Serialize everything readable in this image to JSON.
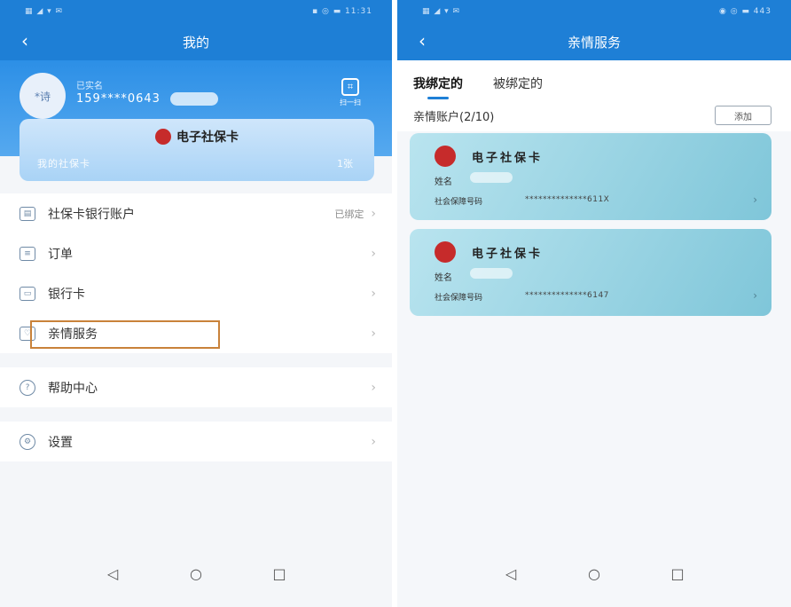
{
  "left": {
    "status_left": "▦ ◢ ▾ ✉",
    "status_right": "▪ ◎ ▬ 11:31",
    "title": "我的",
    "profile": {
      "avatar_text": "*诗",
      "name": "已实名",
      "phone": "159****0643",
      "scan_label": "扫一扫"
    },
    "banner": {
      "title": "电子社保卡",
      "sub": "我的社保卡",
      "count": "1张"
    },
    "menu": [
      {
        "label": "社保卡银行账户",
        "status": "已绑定",
        "icon": "bank-card-icon"
      },
      {
        "label": "订单",
        "status": "",
        "icon": "order-icon"
      },
      {
        "label": "银行卡",
        "status": "",
        "icon": "card-icon"
      },
      {
        "label": "亲情服务",
        "status": "",
        "icon": "family-icon"
      },
      {
        "label": "帮助中心",
        "status": "",
        "icon": "help-icon"
      },
      {
        "label": "设置",
        "status": "",
        "icon": "settings-icon"
      }
    ],
    "chevron": "›",
    "sysnav": {
      "back": "◁",
      "home": "○",
      "recent": "□"
    }
  },
  "right": {
    "status_left": "▦ ◢ ▾ ✉",
    "status_right": "◉ ◎ ▬ 443",
    "title": "亲情服务",
    "tabs": [
      {
        "label": "我绑定的",
        "active": true
      },
      {
        "label": "被绑定的",
        "active": false
      }
    ],
    "account_title": "亲情账户(2/10)",
    "add_label": "添加",
    "cards": [
      {
        "title": "电子社保卡",
        "name_label": "姓名",
        "ssn_label": "社会保障号码",
        "ssn": "**************611X"
      },
      {
        "title": "电子社保卡",
        "name_label": "姓名",
        "ssn_label": "社会保障号码",
        "ssn": "**************6147"
      }
    ],
    "sysnav": {
      "back": "◁",
      "home": "○",
      "recent": "□"
    }
  },
  "colors": {
    "primary": "#1e7fd6",
    "highlight": "#c9823a",
    "card_gradient_start": "#b9e4ef",
    "card_gradient_end": "#7fc6d9"
  }
}
